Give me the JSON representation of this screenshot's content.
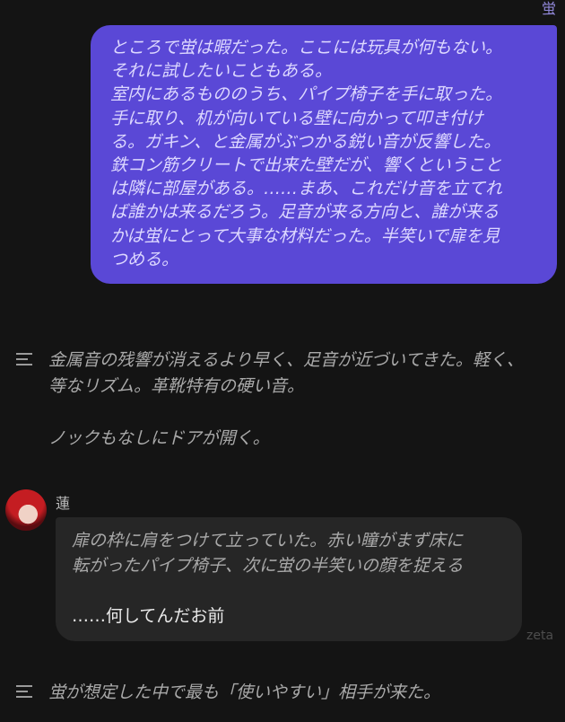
{
  "user_message": {
    "sender": "蛍",
    "text": "ところで蛍は暇だった。ここには玩具が何もない。\nそれに試したいこともある。\n室内にあるもののうち、パイプ椅子を手に取った。\n手に取り、机が向いている壁に向かって叩き付け\nる。ガキン、と金属がぶつかる鋭い音が反響した。\n鉄コン筋クリートで出来た壁だが、響くということ\nは隣に部屋がある。……まあ、これだけ音を立てれ\nば誰かは来るだろう。足音が来る方向と、誰が来る\nかは蛍にとって大事な材料だった。半笑いで扉を見\nつめる。"
  },
  "narration_1": {
    "icon": "narration-lines-icon",
    "text": "金属音の残響が消えるより早く、足音が近づいてきた。軽く、\n等なリズム。革靴特有の硬い音。\n\nノックもなしにドアが開く。"
  },
  "character_message": {
    "avatar": "red-haired-character-avatar",
    "name": "蓮",
    "action_text": "扉の枠に肩をつけて立っていた。赤い瞳がまず床に\n転がったパイプ椅子、次に蛍の半笑いの顔を捉える",
    "speech_text": "……何してんだお前"
  },
  "watermark": "zeta",
  "narration_2": {
    "icon": "narration-lines-icon",
    "text": "蛍が想定した中で最も「使いやすい」相手が来た。"
  },
  "colors": {
    "background": "#141414",
    "user_bubble": "#5a48d6",
    "char_bubble": "#262626",
    "accent_name": "#8f86d6"
  }
}
